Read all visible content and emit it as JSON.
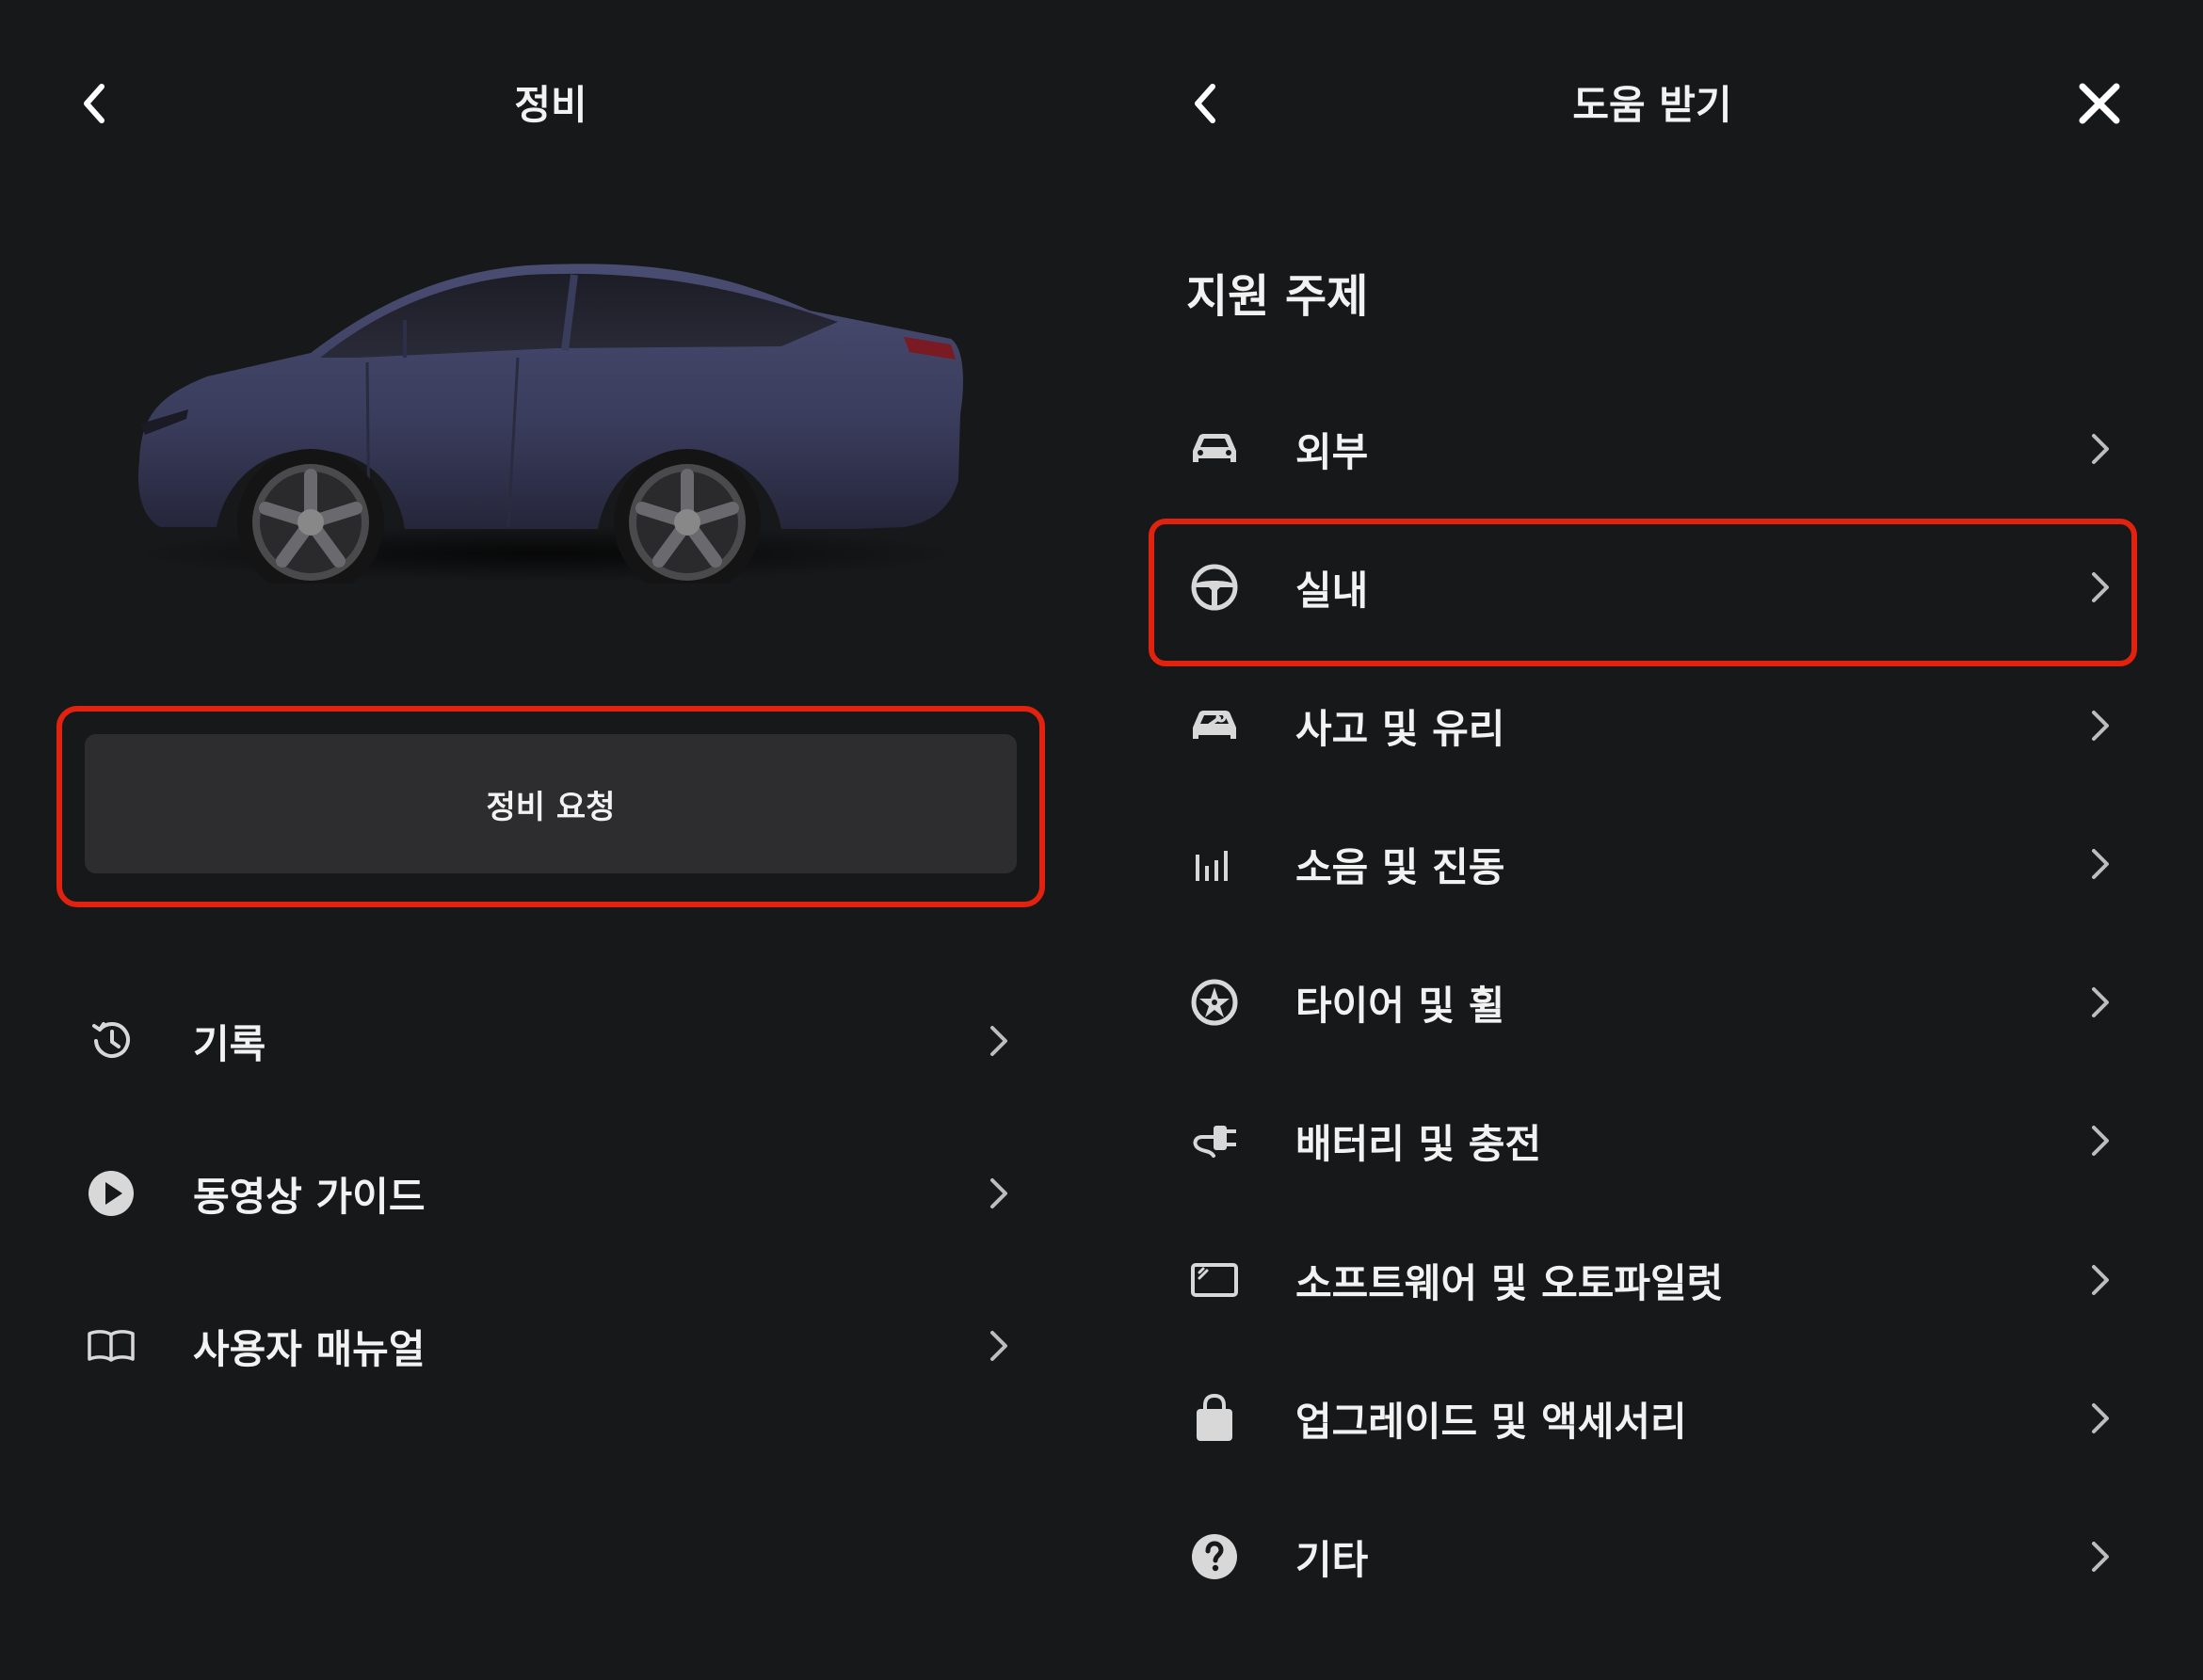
{
  "left": {
    "header": {
      "title": "정비",
      "back_icon": "chevron-left-icon"
    },
    "service_request_label": "정비 요청",
    "items": [
      {
        "label": "기록",
        "icon": "history-icon"
      },
      {
        "label": "동영상 가이드",
        "icon": "play-circle-icon"
      },
      {
        "label": "사용자 매뉴얼",
        "icon": "book-icon"
      }
    ]
  },
  "right": {
    "header": {
      "title": "도움 받기",
      "back_icon": "chevron-left-icon",
      "close_icon": "close-icon"
    },
    "section_title": "지원 주제",
    "items": [
      {
        "label": "외부",
        "icon": "car-icon"
      },
      {
        "label": "실내",
        "icon": "steering-wheel-icon"
      },
      {
        "label": "사고 및 유리",
        "icon": "car-wrench-icon"
      },
      {
        "label": "소음 및 진동",
        "icon": "bars-icon"
      },
      {
        "label": "타이어 및 휠",
        "icon": "wheel-icon"
      },
      {
        "label": "배터리 및 충전",
        "icon": "charging-plug-icon"
      },
      {
        "label": "소프트웨어 및 오토파일럿",
        "icon": "screen-icon"
      },
      {
        "label": "업그레이드 및 액세서리",
        "icon": "shopping-bag-icon"
      },
      {
        "label": "기타",
        "icon": "question-icon"
      }
    ]
  },
  "colors": {
    "background": "#17181a",
    "button": "#2d2d2f",
    "highlight": "#e0220f",
    "text": "#f2f2f2",
    "icon": "#d8d8d8"
  }
}
